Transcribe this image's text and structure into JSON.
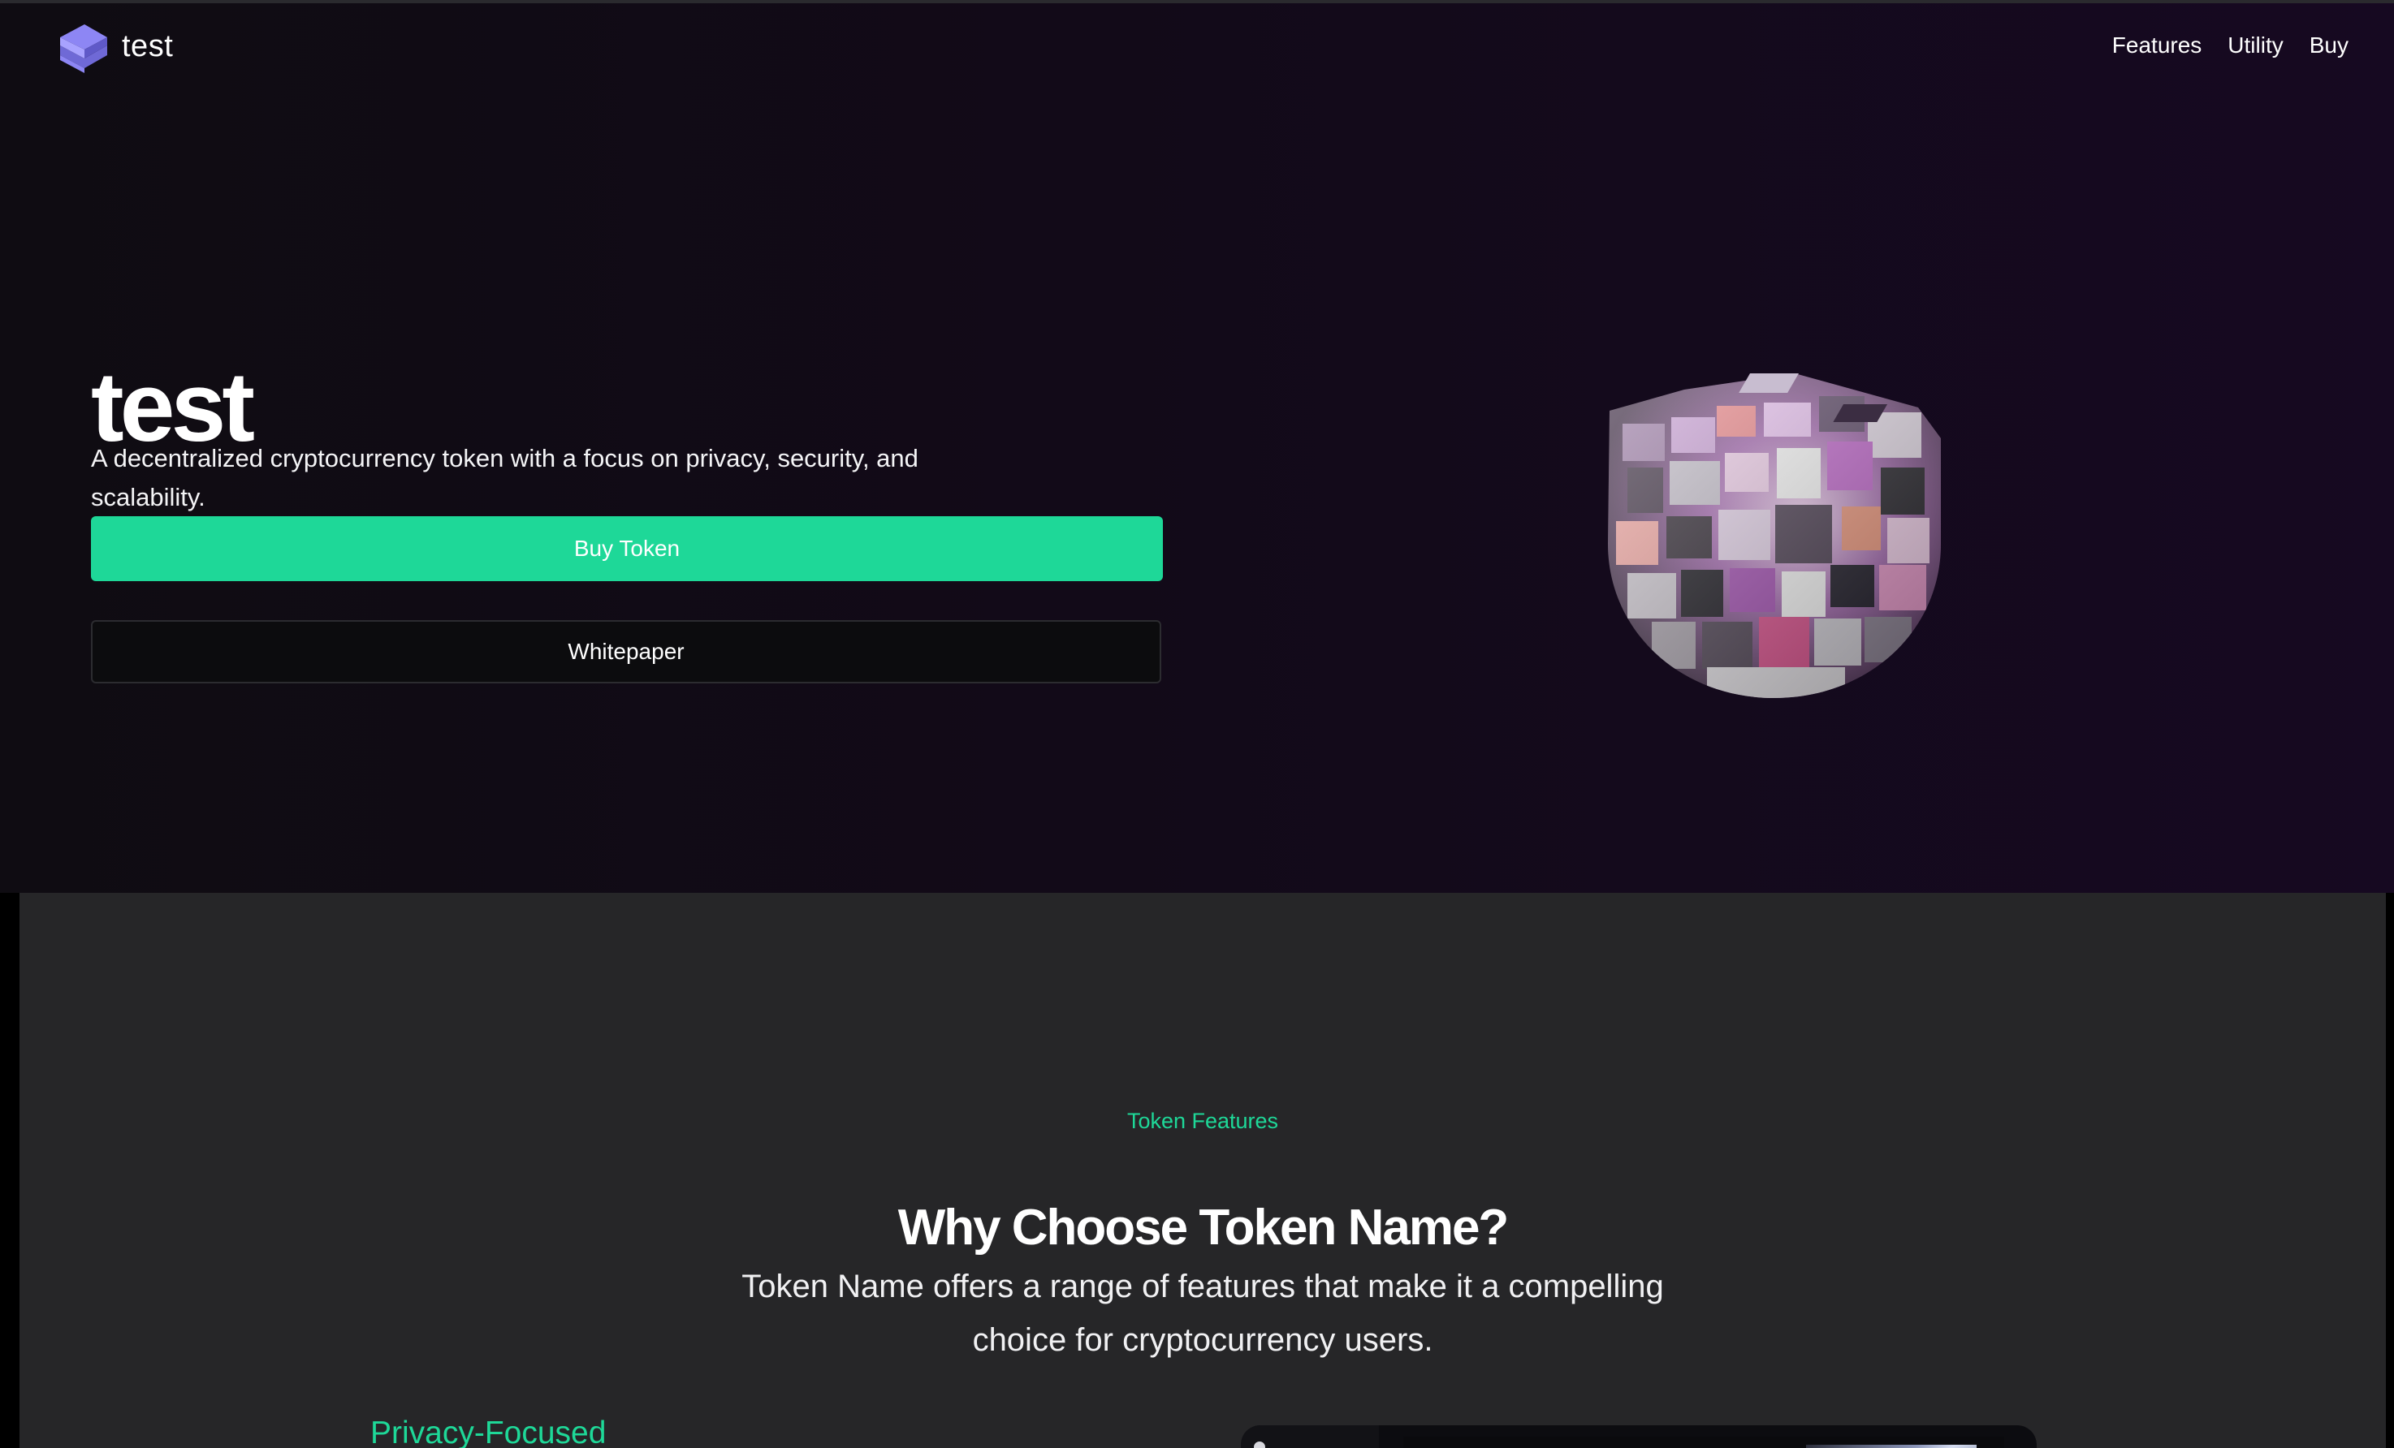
{
  "nav": {
    "brand": "test",
    "links": [
      "Features",
      "Utility",
      "Buy"
    ]
  },
  "hero": {
    "title": "test",
    "description": "A decentralized cryptocurrency token with a focus on privacy, security, and scalability.",
    "primary_button": "Buy Token",
    "secondary_button": "Whitepaper"
  },
  "features": {
    "eyebrow": "Token Features",
    "heading": "Why Choose Token Name?",
    "description": "Token Name offers a range of features that make it a compelling choice for cryptocurrency users.",
    "first_item_title": "Privacy-Focused"
  },
  "colors": {
    "accent": "#1ed898",
    "hero_bg": "#140b1c",
    "section_bg": "#262628",
    "logo": "#8d86f4"
  },
  "icons": {
    "logo": "stacked-s-logo-icon",
    "hero_image": "cube-sphere-illustration"
  }
}
